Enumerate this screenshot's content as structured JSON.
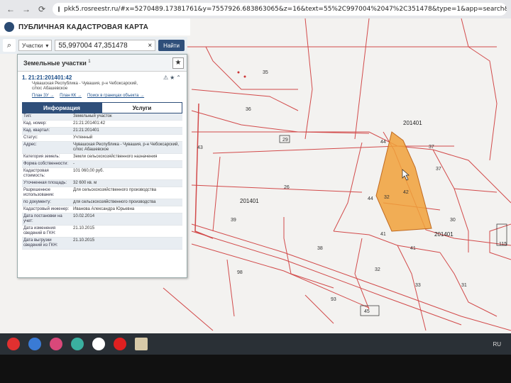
{
  "browser": {
    "url": "pkk5.rosreestr.ru/#x=5270489.17381761&y=7557926.683863065&z=16&text=55%2C997004%2047%2C351478&type=1&app=search&opened=1"
  },
  "header": {
    "title": "ПУБЛИЧНАЯ КАДАСТРОВАЯ КАРТА"
  },
  "search": {
    "type_label": "Участки",
    "value": "55,997004 47,351478",
    "clear": "×",
    "button": "Найти"
  },
  "panel": {
    "title": "Земельные участки",
    "count": "1",
    "star": "★",
    "item": {
      "index": "1.",
      "number": "21:21:201401:42",
      "icons": "⚠★⌃",
      "address": "Чувашская Республика - Чувашия, р-н Чебоксарский, с/пос Абашевское",
      "links": [
        "План ЗУ →",
        "План КК →",
        "Поиск в границах объекта →"
      ]
    },
    "tabs": [
      "Информация",
      "Услуги"
    ],
    "props": [
      {
        "key": "Тип:",
        "value": "Земельный участок"
      },
      {
        "key": "Кад. номер:",
        "value": "21:21:201401:42"
      },
      {
        "key": "Кад. квартал:",
        "value": "21:21:201401"
      },
      {
        "key": "Статус:",
        "value": "Учтенный"
      },
      {
        "key": "Адрес:",
        "value": "Чувашская Республика - Чувашия, р-н Чебоксарский, с/пос Абашевское"
      },
      {
        "key": "Категория земель:",
        "value": "Земли сельскохозяйственного назначения"
      },
      {
        "key": "Форма собственности:",
        "value": "-"
      },
      {
        "key": "Кадастровая стоимость:",
        "value": "101 060,00 руб."
      },
      {
        "key": "Уточненная площадь:",
        "value": "32 600 кв. м"
      },
      {
        "key": "Разрешенное использование:",
        "value": "Для сельскохозяйственного производства"
      },
      {
        "key": "по документу:",
        "value": "для сельскохозяйственного производства"
      },
      {
        "key": "Кадастровый инженер:",
        "value": "Иванова Александра Юрьевна"
      },
      {
        "key": "Дата постановки на учет:",
        "value": "10.02.2014"
      },
      {
        "key": "Дата изменения сведений в ГКН:",
        "value": "21.10.2015"
      },
      {
        "key": "Дата выгрузки сведений из ГКН:",
        "value": "21.10.2015"
      }
    ]
  },
  "map": {
    "quarters": [
      "201401",
      "201401",
      "201401"
    ],
    "parcels": [
      "35",
      "36",
      "29",
      "43",
      "44",
      "37",
      "26",
      "44",
      "32",
      "42",
      "37",
      "39",
      "30",
      "41",
      "38",
      "41",
      "98",
      "32",
      "93",
      "45",
      "33",
      "31",
      "115"
    ],
    "highlight_color": "#f0a13a",
    "border_color": "#d24a4a"
  },
  "taskbar": {
    "lang": "RU"
  }
}
